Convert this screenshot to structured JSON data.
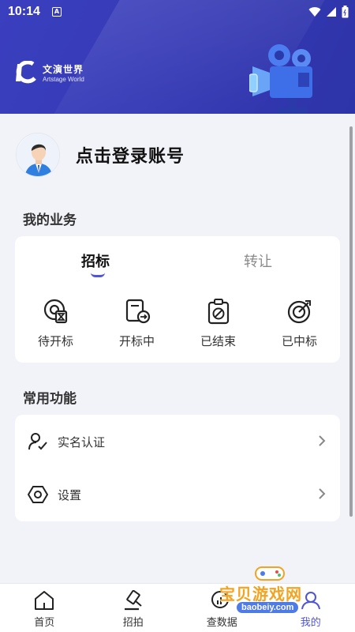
{
  "status_bar": {
    "time": "10:14",
    "indicator": "A"
  },
  "brand": {
    "name_cn": "文演世界",
    "name_en": "Artstage World"
  },
  "profile": {
    "login_text": "点击登录账号"
  },
  "business": {
    "title": "我的业务",
    "tabs": [
      {
        "label": "招标",
        "active": true
      },
      {
        "label": "转让",
        "active": false
      }
    ],
    "items": [
      {
        "label": "待开标",
        "icon": "hourglass-icon"
      },
      {
        "label": "开标中",
        "icon": "document-arrow-icon"
      },
      {
        "label": "已结束",
        "icon": "clipboard-slash-icon"
      },
      {
        "label": "已中标",
        "icon": "target-icon"
      }
    ]
  },
  "functions": {
    "title": "常用功能",
    "items": [
      {
        "label": "实名认证",
        "icon": "user-check-icon"
      },
      {
        "label": "设置",
        "icon": "gear-icon"
      }
    ]
  },
  "bottom_nav": [
    {
      "label": "首页",
      "icon": "home-icon",
      "active": false
    },
    {
      "label": "招拍",
      "icon": "gavel-icon",
      "active": false
    },
    {
      "label": "查数据",
      "icon": "chart-icon",
      "active": false
    },
    {
      "label": "我的",
      "icon": "profile-icon",
      "active": true
    }
  ],
  "watermark": {
    "text": "宝贝游戏网",
    "url": "baobeiy.com"
  },
  "colors": {
    "header": "#3539b4",
    "accent": "#4f55d6",
    "background": "#f2f3f8"
  }
}
